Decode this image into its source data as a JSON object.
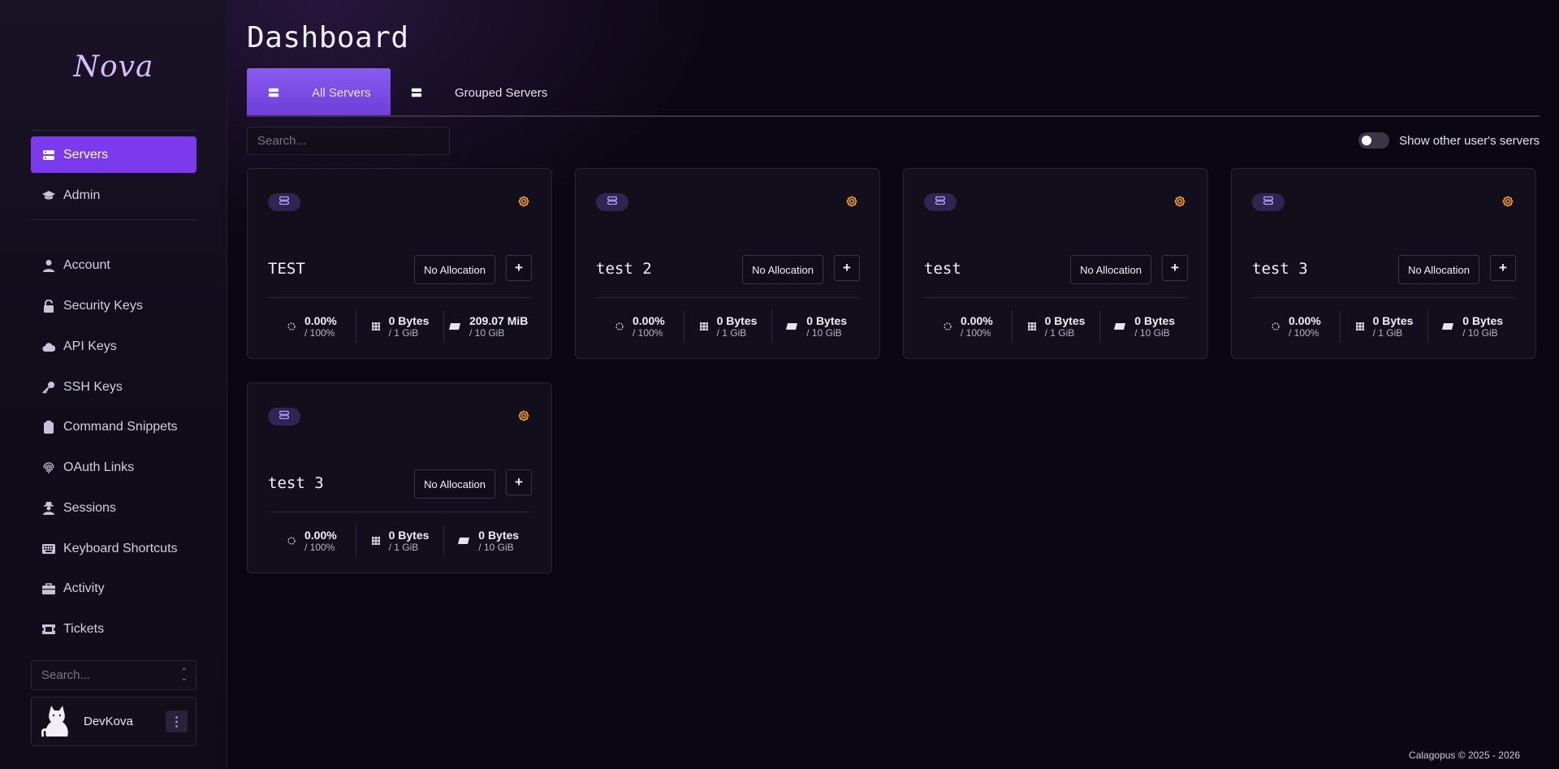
{
  "brand": {
    "logo_text": "Nova"
  },
  "sidebar": {
    "primary": [
      {
        "label": "Servers",
        "icon": "server-icon",
        "active": true
      },
      {
        "label": "Admin",
        "icon": "graduation-cap-icon",
        "active": false
      }
    ],
    "items": [
      {
        "label": "Account",
        "icon": "user-icon"
      },
      {
        "label": "Security Keys",
        "icon": "lock-open-icon"
      },
      {
        "label": "API Keys",
        "icon": "cloud-icon"
      },
      {
        "label": "SSH Keys",
        "icon": "key-icon"
      },
      {
        "label": "Command Snippets",
        "icon": "clipboard-icon"
      },
      {
        "label": "OAuth Links",
        "icon": "fingerprint-icon"
      },
      {
        "label": "Sessions",
        "icon": "user-secret-icon"
      },
      {
        "label": "Keyboard Shortcuts",
        "icon": "keyboard-icon"
      },
      {
        "label": "Activity",
        "icon": "briefcase-icon"
      },
      {
        "label": "Tickets",
        "icon": "ticket-icon"
      }
    ],
    "search_placeholder": "Search...",
    "user": {
      "name": "DevKova"
    }
  },
  "page": {
    "title": "Dashboard",
    "tabs": [
      {
        "label": "All Servers",
        "active": true
      },
      {
        "label": "Grouped Servers",
        "active": false
      }
    ],
    "search_placeholder": "Search...",
    "toggle_label": "Show other user's servers",
    "toggle_on": false
  },
  "servers": [
    {
      "name": "TEST",
      "allocation": "No Allocation",
      "cpu": "0.00%",
      "cpu_limit": "/ 100%",
      "memory": "0 Bytes",
      "memory_limit": "/ 1 GiB",
      "disk": "209.07 MiB",
      "disk_limit": "/ 10 GiB"
    },
    {
      "name": "test 2",
      "allocation": "No Allocation",
      "cpu": "0.00%",
      "cpu_limit": "/ 100%",
      "memory": "0 Bytes",
      "memory_limit": "/ 1 GiB",
      "disk": "0 Bytes",
      "disk_limit": "/ 10 GiB"
    },
    {
      "name": "test",
      "allocation": "No Allocation",
      "cpu": "0.00%",
      "cpu_limit": "/ 100%",
      "memory": "0 Bytes",
      "memory_limit": "/ 1 GiB",
      "disk": "0 Bytes",
      "disk_limit": "/ 10 GiB"
    },
    {
      "name": "test 3",
      "allocation": "No Allocation",
      "cpu": "0.00%",
      "cpu_limit": "/ 100%",
      "memory": "0 Bytes",
      "memory_limit": "/ 1 GiB",
      "disk": "0 Bytes",
      "disk_limit": "/ 10 GiB"
    },
    {
      "name": "test 3",
      "allocation": "No Allocation",
      "cpu": "0.00%",
      "cpu_limit": "/ 100%",
      "memory": "0 Bytes",
      "memory_limit": "/ 1 GiB",
      "disk": "0 Bytes",
      "disk_limit": "/ 10 GiB"
    }
  ],
  "footer": {
    "brand": "Calagopus",
    "copyright": "© 2025 - 2026"
  },
  "colors": {
    "accent": "#7c3aed",
    "gear": "#f59e0b",
    "background": "#0b0712"
  }
}
